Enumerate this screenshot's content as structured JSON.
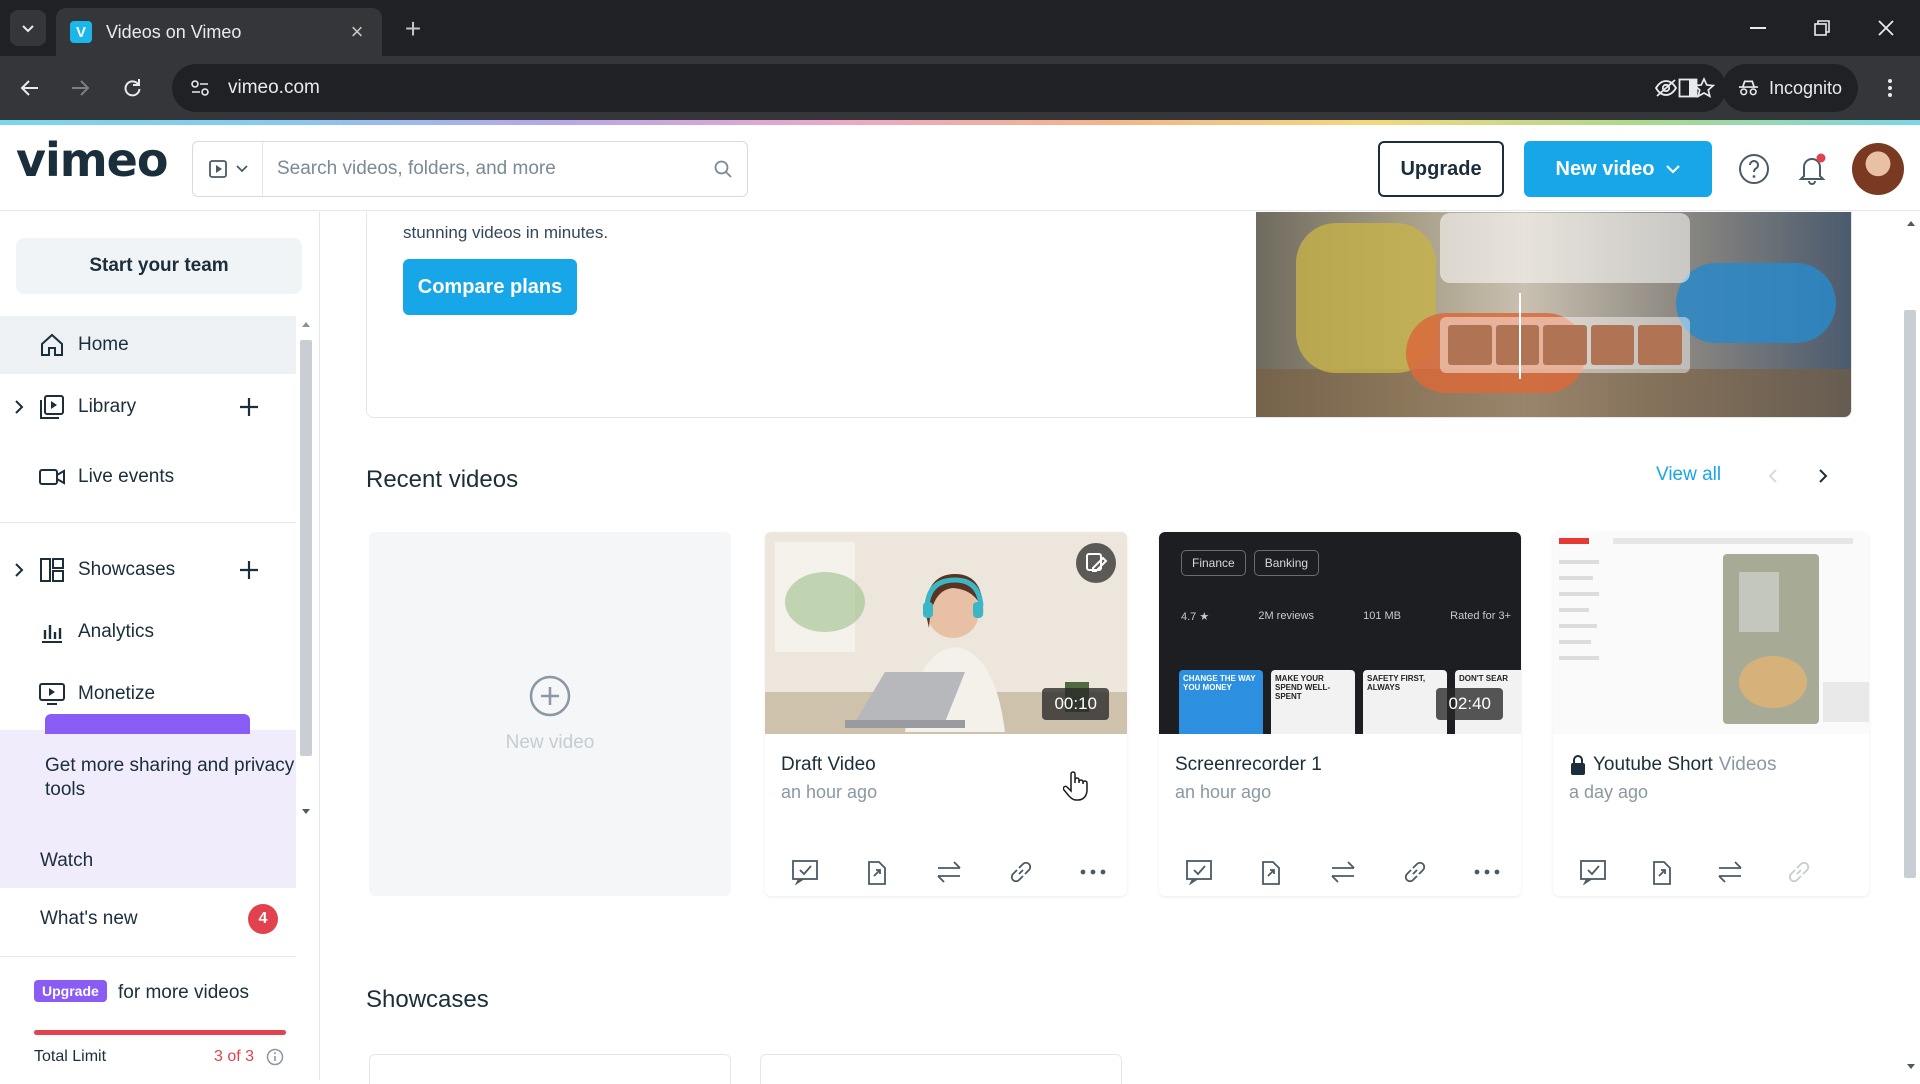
{
  "browser": {
    "tab_title": "Videos on Vimeo",
    "tab_favicon": "V",
    "url": "vimeo.com",
    "incognito_label": "Incognito"
  },
  "header": {
    "logo": "vimeo",
    "search_placeholder": "Search videos, folders, and more",
    "upgrade_label": "Upgrade",
    "new_video_label": "New video"
  },
  "sidebar": {
    "team_button": "Start your team",
    "items": [
      {
        "label": "Home",
        "icon": "home-icon"
      },
      {
        "label": "Library",
        "icon": "library-icon"
      },
      {
        "label": "Live events",
        "icon": "camera-icon"
      },
      {
        "label": "Showcases",
        "icon": "showcase-icon"
      },
      {
        "label": "Analytics",
        "icon": "analytics-icon"
      },
      {
        "label": "Monetize",
        "icon": "monetize-icon"
      }
    ],
    "promo_text": "Get more sharing and privacy tools",
    "watch_label": "Watch",
    "whats_new_label": "What's new",
    "whats_new_count": "4",
    "upgrade_pill": "Upgrade",
    "upgrade_text": "for more videos",
    "total_limit_label": "Total Limit",
    "total_limit_value": "3 of 3",
    "total_limit_fraction": 1.0
  },
  "main": {
    "banner_text": "stunning videos in minutes.",
    "compare_label": "Compare plans",
    "recent_title": "Recent videos",
    "view_all_label": "View all",
    "new_video_card_label": "New video",
    "videos": [
      {
        "title": "Draft Video",
        "time": "an hour ago",
        "duration": "00:10"
      },
      {
        "title": "Screenrecorder 1",
        "time": "an hour ago",
        "duration": "02:40"
      },
      {
        "title": "Youtube Short",
        "title_suffix": "Videos",
        "time": "a day ago",
        "private": true
      }
    ],
    "screen_thumb": {
      "chips": [
        "Finance",
        "Banking"
      ],
      "stats": [
        "4.7 ★",
        "2M reviews",
        "101 MB",
        "Rated for 3+"
      ],
      "cards": [
        "CHANGE THE WAY YOU MONEY",
        "MAKE YOUR SPEND WELL-SPENT",
        "SAFETY FIRST, ALWAYS",
        "DON'T SEAR"
      ]
    },
    "showcases_title": "Showcases"
  },
  "colors": {
    "accent": "#17a6e8",
    "purple": "#8a5cf6",
    "alert": "#e2424d"
  }
}
